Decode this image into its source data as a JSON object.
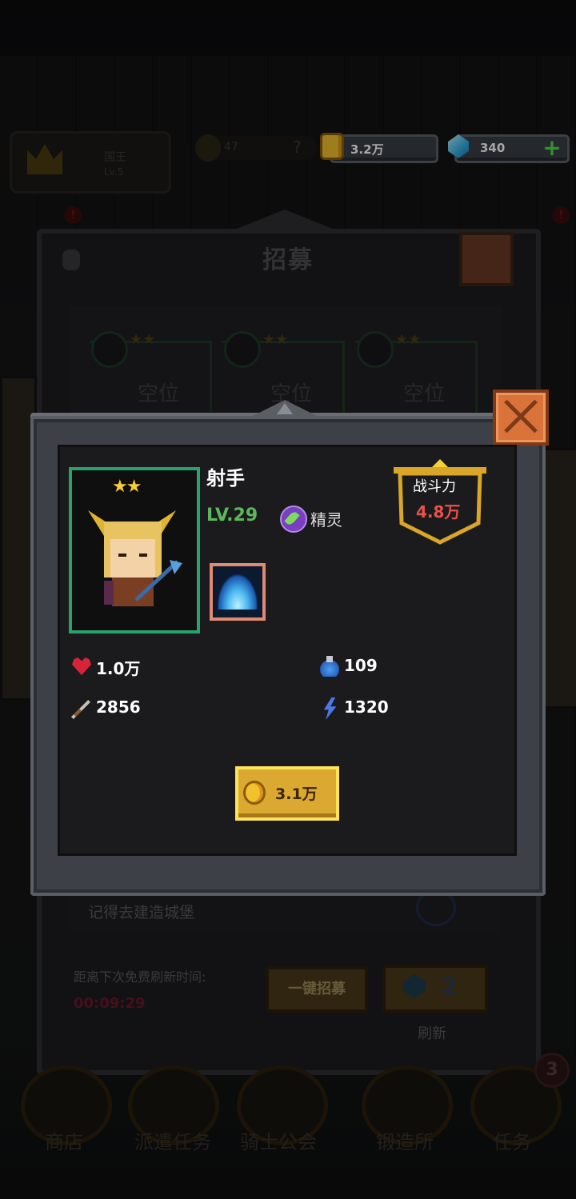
{
  "top_bar": {
    "crown_label_line1": "国王",
    "crown_label_line2": "Lv.5",
    "medal_value": "47",
    "medal_q": "?",
    "gold": "3.2万",
    "gems": "340",
    "plus_icon": "+"
  },
  "recruit_panel": {
    "title": "招募",
    "slots": [
      {
        "label": "空位",
        "stars": "★★"
      },
      {
        "label": "空位",
        "stars": "★★"
      },
      {
        "label": "空位",
        "stars": "★★"
      }
    ],
    "hint_line": "记得去建造城堡",
    "refresh_timer_label": "距离下次免费刷新时间:",
    "refresh_timer": "00:09:29",
    "recruit_all_label": "一键招募",
    "refresh_cost": "2",
    "refresh_label": "刷新"
  },
  "hero_modal": {
    "stars": "★★",
    "name": "射手",
    "level": "LV.29",
    "race": "精灵",
    "power_label": "战斗力",
    "power_value": "4.8万",
    "stats": {
      "hp": "1.0万",
      "mana": "109",
      "attack": "2856",
      "speed": "1320"
    },
    "price": "3.1万"
  },
  "bottom_nav": [
    {
      "label": "商店"
    },
    {
      "label": "派遣任务"
    },
    {
      "label": "骑士公会"
    },
    {
      "label": "锻造所"
    },
    {
      "label": "任务",
      "badge": "3"
    }
  ],
  "colors": {
    "accent_gold": "#f2c12e",
    "frame_green": "#2aa26e",
    "power_red": "#e8524a",
    "level_green": "#5cb85c",
    "timer_red": "#6a1a2a"
  }
}
